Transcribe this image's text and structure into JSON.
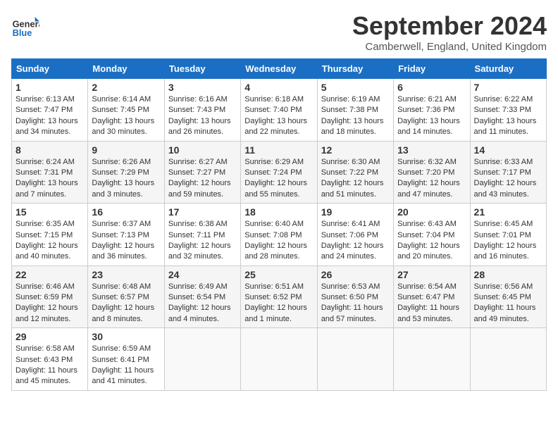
{
  "header": {
    "logo_general": "General",
    "logo_blue": "Blue",
    "month_title": "September 2024",
    "location": "Camberwell, England, United Kingdom"
  },
  "weekdays": [
    "Sunday",
    "Monday",
    "Tuesday",
    "Wednesday",
    "Thursday",
    "Friday",
    "Saturday"
  ],
  "weeks": [
    [
      {
        "day": "1",
        "sunrise": "6:13 AM",
        "sunset": "7:47 PM",
        "daylight": "13 hours and 34 minutes."
      },
      {
        "day": "2",
        "sunrise": "6:14 AM",
        "sunset": "7:45 PM",
        "daylight": "13 hours and 30 minutes."
      },
      {
        "day": "3",
        "sunrise": "6:16 AM",
        "sunset": "7:43 PM",
        "daylight": "13 hours and 26 minutes."
      },
      {
        "day": "4",
        "sunrise": "6:18 AM",
        "sunset": "7:40 PM",
        "daylight": "13 hours and 22 minutes."
      },
      {
        "day": "5",
        "sunrise": "6:19 AM",
        "sunset": "7:38 PM",
        "daylight": "13 hours and 18 minutes."
      },
      {
        "day": "6",
        "sunrise": "6:21 AM",
        "sunset": "7:36 PM",
        "daylight": "13 hours and 14 minutes."
      },
      {
        "day": "7",
        "sunrise": "6:22 AM",
        "sunset": "7:33 PM",
        "daylight": "13 hours and 11 minutes."
      }
    ],
    [
      {
        "day": "8",
        "sunrise": "6:24 AM",
        "sunset": "7:31 PM",
        "daylight": "13 hours and 7 minutes."
      },
      {
        "day": "9",
        "sunrise": "6:26 AM",
        "sunset": "7:29 PM",
        "daylight": "13 hours and 3 minutes."
      },
      {
        "day": "10",
        "sunrise": "6:27 AM",
        "sunset": "7:27 PM",
        "daylight": "12 hours and 59 minutes."
      },
      {
        "day": "11",
        "sunrise": "6:29 AM",
        "sunset": "7:24 PM",
        "daylight": "12 hours and 55 minutes."
      },
      {
        "day": "12",
        "sunrise": "6:30 AM",
        "sunset": "7:22 PM",
        "daylight": "12 hours and 51 minutes."
      },
      {
        "day": "13",
        "sunrise": "6:32 AM",
        "sunset": "7:20 PM",
        "daylight": "12 hours and 47 minutes."
      },
      {
        "day": "14",
        "sunrise": "6:33 AM",
        "sunset": "7:17 PM",
        "daylight": "12 hours and 43 minutes."
      }
    ],
    [
      {
        "day": "15",
        "sunrise": "6:35 AM",
        "sunset": "7:15 PM",
        "daylight": "12 hours and 40 minutes."
      },
      {
        "day": "16",
        "sunrise": "6:37 AM",
        "sunset": "7:13 PM",
        "daylight": "12 hours and 36 minutes."
      },
      {
        "day": "17",
        "sunrise": "6:38 AM",
        "sunset": "7:11 PM",
        "daylight": "12 hours and 32 minutes."
      },
      {
        "day": "18",
        "sunrise": "6:40 AM",
        "sunset": "7:08 PM",
        "daylight": "12 hours and 28 minutes."
      },
      {
        "day": "19",
        "sunrise": "6:41 AM",
        "sunset": "7:06 PM",
        "daylight": "12 hours and 24 minutes."
      },
      {
        "day": "20",
        "sunrise": "6:43 AM",
        "sunset": "7:04 PM",
        "daylight": "12 hours and 20 minutes."
      },
      {
        "day": "21",
        "sunrise": "6:45 AM",
        "sunset": "7:01 PM",
        "daylight": "12 hours and 16 minutes."
      }
    ],
    [
      {
        "day": "22",
        "sunrise": "6:46 AM",
        "sunset": "6:59 PM",
        "daylight": "12 hours and 12 minutes."
      },
      {
        "day": "23",
        "sunrise": "6:48 AM",
        "sunset": "6:57 PM",
        "daylight": "12 hours and 8 minutes."
      },
      {
        "day": "24",
        "sunrise": "6:49 AM",
        "sunset": "6:54 PM",
        "daylight": "12 hours and 4 minutes."
      },
      {
        "day": "25",
        "sunrise": "6:51 AM",
        "sunset": "6:52 PM",
        "daylight": "12 hours and 1 minute."
      },
      {
        "day": "26",
        "sunrise": "6:53 AM",
        "sunset": "6:50 PM",
        "daylight": "11 hours and 57 minutes."
      },
      {
        "day": "27",
        "sunrise": "6:54 AM",
        "sunset": "6:47 PM",
        "daylight": "11 hours and 53 minutes."
      },
      {
        "day": "28",
        "sunrise": "6:56 AM",
        "sunset": "6:45 PM",
        "daylight": "11 hours and 49 minutes."
      }
    ],
    [
      {
        "day": "29",
        "sunrise": "6:58 AM",
        "sunset": "6:43 PM",
        "daylight": "11 hours and 45 minutes."
      },
      {
        "day": "30",
        "sunrise": "6:59 AM",
        "sunset": "6:41 PM",
        "daylight": "11 hours and 41 minutes."
      },
      null,
      null,
      null,
      null,
      null
    ]
  ]
}
